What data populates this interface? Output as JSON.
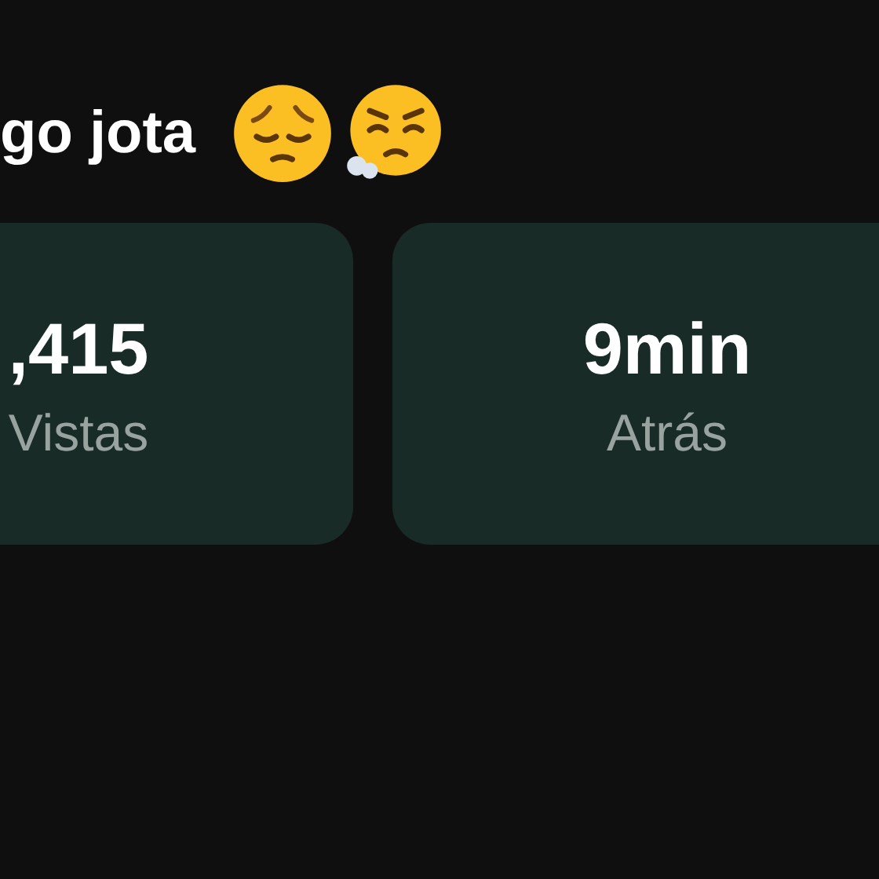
{
  "title": "go jota",
  "stats": [
    {
      "value": ",415",
      "label": "Vistas"
    },
    {
      "value": "9min",
      "label": "Atrás"
    }
  ]
}
